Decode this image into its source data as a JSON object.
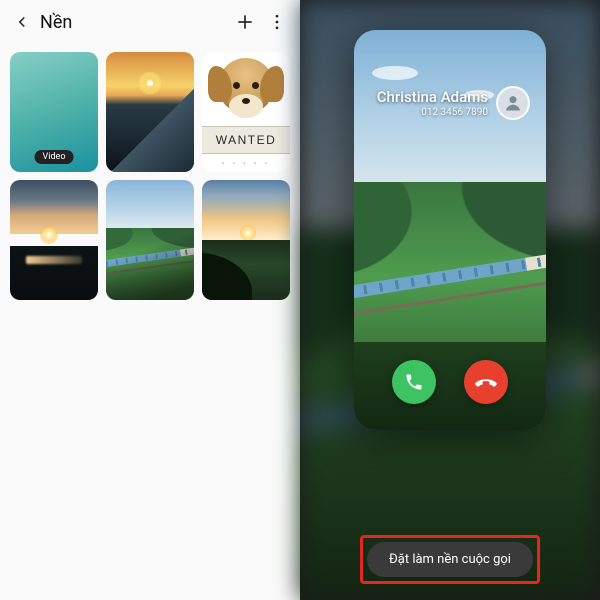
{
  "left": {
    "title": "Nền",
    "tiles": {
      "video_badge": "Video",
      "wanted_label": "WANTED",
      "dots": "• • • • •"
    }
  },
  "right": {
    "caller_name": "Christina Adams",
    "caller_number": "012 3456 7890",
    "set_button": "Đặt làm nền cuộc gọi"
  },
  "icons": {
    "back": "back-chevron",
    "add": "plus",
    "more": "more-vertical",
    "accept": "phone",
    "decline": "phone-down",
    "avatar": "user"
  }
}
